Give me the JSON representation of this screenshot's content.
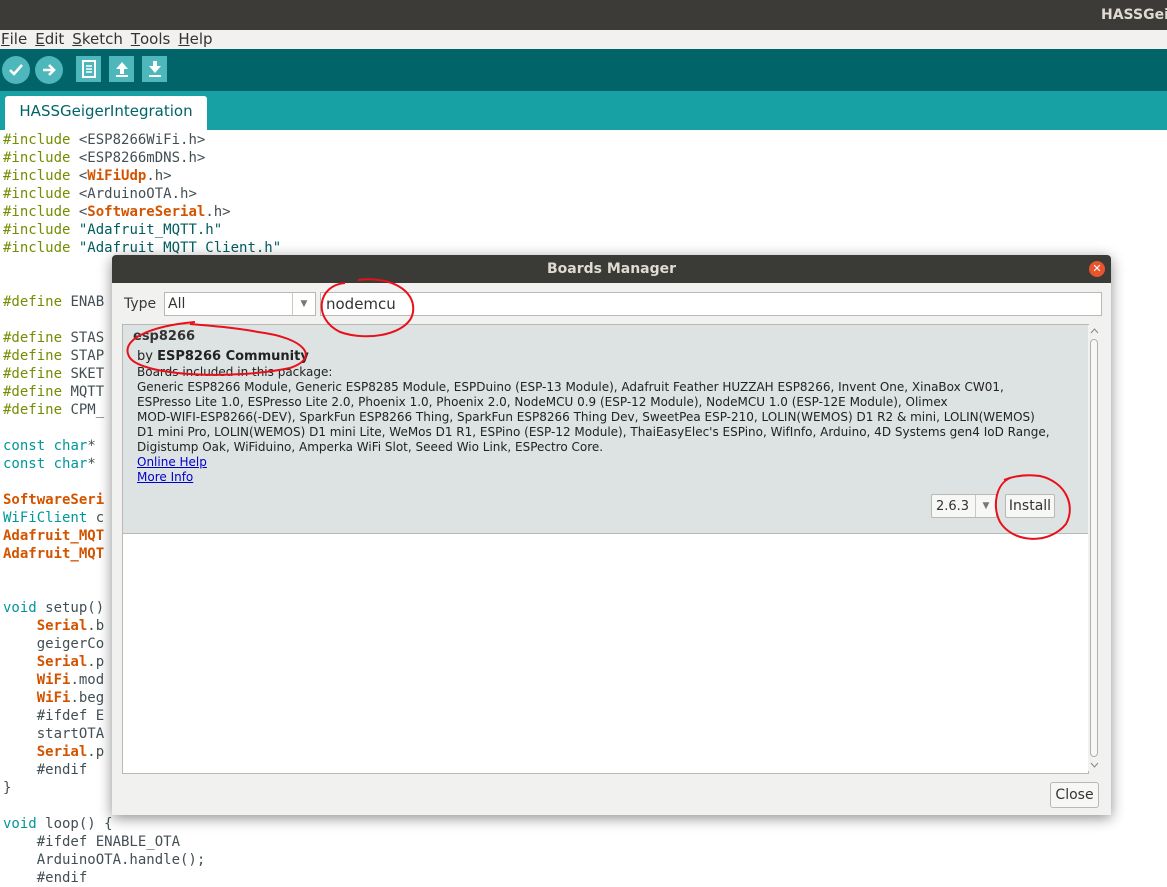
{
  "window": {
    "title": "HASSGeiger"
  },
  "menu": [
    {
      "key": "F",
      "rest": "ile"
    },
    {
      "key": "E",
      "rest": "dit"
    },
    {
      "key": "S",
      "rest": "ketch"
    },
    {
      "key": "T",
      "rest": "ools"
    },
    {
      "key": "H",
      "rest": "elp"
    }
  ],
  "toolbar": {
    "icons": [
      "verify-icon",
      "upload-icon",
      "new-icon",
      "open-icon",
      "save-icon"
    ]
  },
  "tab": {
    "label": "HASSGeigerIntegration"
  },
  "code": [
    {
      "l": 1,
      "parts": [
        [
          "kw",
          "#include"
        ],
        [
          "",
          "<ESP8266WiFi.h>"
        ]
      ]
    },
    {
      "l": 2,
      "parts": [
        [
          "kw",
          "#include"
        ],
        [
          "",
          "<ESP8266mDNS.h>"
        ]
      ]
    },
    {
      "l": 3,
      "parts": [
        [
          "kw",
          "#include"
        ],
        [
          "",
          "<"
        ],
        [
          "or",
          "WiFiUdp"
        ],
        [
          "",
          ".h>"
        ]
      ]
    },
    {
      "l": 4,
      "parts": [
        [
          "kw",
          "#include"
        ],
        [
          "",
          "<ArduinoOTA.h>"
        ]
      ]
    },
    {
      "l": 5,
      "parts": [
        [
          "kw",
          "#include"
        ],
        [
          "",
          "<"
        ],
        [
          "or",
          "SoftwareSerial"
        ],
        [
          "",
          ".h>"
        ]
      ]
    },
    {
      "l": 6,
      "parts": [
        [
          "kw",
          "#include"
        ],
        [
          "st",
          "\"Adafruit_MQTT.h\""
        ]
      ]
    },
    {
      "l": 7,
      "parts": [
        [
          "kw",
          "#include"
        ],
        [
          "st",
          "\"Adafruit_MQTT_Client.h\""
        ]
      ]
    },
    {
      "l": 10,
      "parts": [
        [
          "kw",
          "#define"
        ],
        [
          "",
          "ENAB"
        ]
      ]
    },
    {
      "l": 12,
      "parts": [
        [
          "kw",
          "#define"
        ],
        [
          "",
          "STAS"
        ]
      ]
    },
    {
      "l": 13,
      "parts": [
        [
          "kw",
          "#define"
        ],
        [
          "",
          "STAP"
        ]
      ]
    },
    {
      "l": 14,
      "parts": [
        [
          "kw",
          "#define"
        ],
        [
          "",
          "SKET"
        ]
      ]
    },
    {
      "l": 15,
      "parts": [
        [
          "kw",
          "#define"
        ],
        [
          "",
          "MQTT"
        ]
      ]
    },
    {
      "l": 16,
      "parts": [
        [
          "kw",
          "#define"
        ],
        [
          "",
          "CPM_"
        ]
      ]
    },
    {
      "l": 18,
      "parts": [
        [
          "ty",
          "const"
        ],
        [
          "ty",
          "char"
        ],
        [
          "",
          "*"
        ]
      ]
    },
    {
      "l": 19,
      "parts": [
        [
          "ty",
          "const"
        ],
        [
          "ty",
          "char"
        ],
        [
          "",
          "*"
        ]
      ]
    },
    {
      "l": 21,
      "parts": [
        [
          "or",
          "SoftwareSeri"
        ]
      ]
    },
    {
      "l": 22,
      "parts": [
        [
          "ty",
          "WiFiClient"
        ],
        [
          "",
          "c"
        ]
      ]
    },
    {
      "l": 23,
      "parts": [
        [
          "or",
          "Adafruit_MQT"
        ]
      ]
    },
    {
      "l": 24,
      "parts": [
        [
          "or",
          "Adafruit_MQT"
        ]
      ]
    },
    {
      "l": 27,
      "parts": [
        [
          "ty",
          "void"
        ],
        [
          "",
          "setup()"
        ]
      ]
    },
    {
      "l": 28,
      "parts": [
        [
          "",
          "    "
        ],
        [
          "or",
          "Serial"
        ],
        [
          "",
          ".b"
        ]
      ]
    },
    {
      "l": 29,
      "parts": [
        [
          "",
          "    geigerCo"
        ]
      ]
    },
    {
      "l": 30,
      "parts": [
        [
          "",
          "    "
        ],
        [
          "or",
          "Serial"
        ],
        [
          "",
          ".p"
        ]
      ]
    },
    {
      "l": 31,
      "parts": [
        [
          "",
          "    "
        ],
        [
          "or",
          "WiFi"
        ],
        [
          "",
          ".mod"
        ]
      ]
    },
    {
      "l": 32,
      "parts": [
        [
          "",
          "    "
        ],
        [
          "or",
          "WiFi"
        ],
        [
          "",
          ".beg"
        ]
      ]
    },
    {
      "l": 33,
      "parts": [
        [
          "",
          "    #ifdef E"
        ]
      ]
    },
    {
      "l": 34,
      "parts": [
        [
          "",
          "    startOTA"
        ]
      ]
    },
    {
      "l": 35,
      "parts": [
        [
          "",
          "    "
        ],
        [
          "or",
          "Serial"
        ],
        [
          "",
          ".p"
        ]
      ]
    },
    {
      "l": 36,
      "parts": [
        [
          "",
          "    #endif"
        ]
      ]
    },
    {
      "l": 37,
      "parts": [
        [
          "",
          "}"
        ]
      ]
    },
    {
      "l": 39,
      "parts": [
        [
          "ty",
          "void"
        ],
        [
          "",
          "loop() {"
        ]
      ]
    },
    {
      "l": 40,
      "parts": [
        [
          "",
          "    #ifdef ENABLE_OTA"
        ]
      ]
    },
    {
      "l": 41,
      "parts": [
        [
          "",
          "    ArduinoOTA.handle();"
        ]
      ]
    },
    {
      "l": 42,
      "parts": [
        [
          "",
          "    #endif"
        ]
      ]
    }
  ],
  "dialog": {
    "title": "Boards Manager",
    "type_label": "Type",
    "type_value": "All",
    "search_value": "nodemcu",
    "package": {
      "name": "esp8266",
      "by_prefix": "by",
      "author": "ESP8266 Community",
      "boards_label": "Boards included in this package:",
      "boards_lines": [
        "Generic ESP8266 Module, Generic ESP8285 Module, ESPDuino (ESP-13 Module), Adafruit Feather HUZZAH ESP8266, Invent One, XinaBox CW01,",
        "ESPresso Lite 1.0, ESPresso Lite 2.0, Phoenix 1.0, Phoenix 2.0, NodeMCU 0.9 (ESP-12 Module), NodeMCU 1.0 (ESP-12E Module), Olimex",
        "MOD-WIFI-ESP8266(-DEV), SparkFun ESP8266 Thing, SparkFun ESP8266 Thing Dev, SweetPea ESP-210, LOLIN(WEMOS) D1 R2 & mini, LOLIN(WEMOS)",
        "D1 mini Pro, LOLIN(WEMOS) D1 mini Lite, WeMos D1 R1, ESPino (ESP-12 Module), ThaiEasyElec's ESPino, WifInfo, Arduino, 4D Systems gen4 IoD Range,",
        "Digistump Oak, WiFiduino, Amperka WiFi Slot, Seeed Wio Link, ESPectro Core."
      ],
      "online_help": "Online Help",
      "more_info": "More Info",
      "version": "2.6.3",
      "install_label": "Install"
    },
    "close_label": "Close"
  },
  "colors": {
    "toolbar": "#006468",
    "tabbar": "#17a1a5",
    "annotation": "#e8101b"
  }
}
